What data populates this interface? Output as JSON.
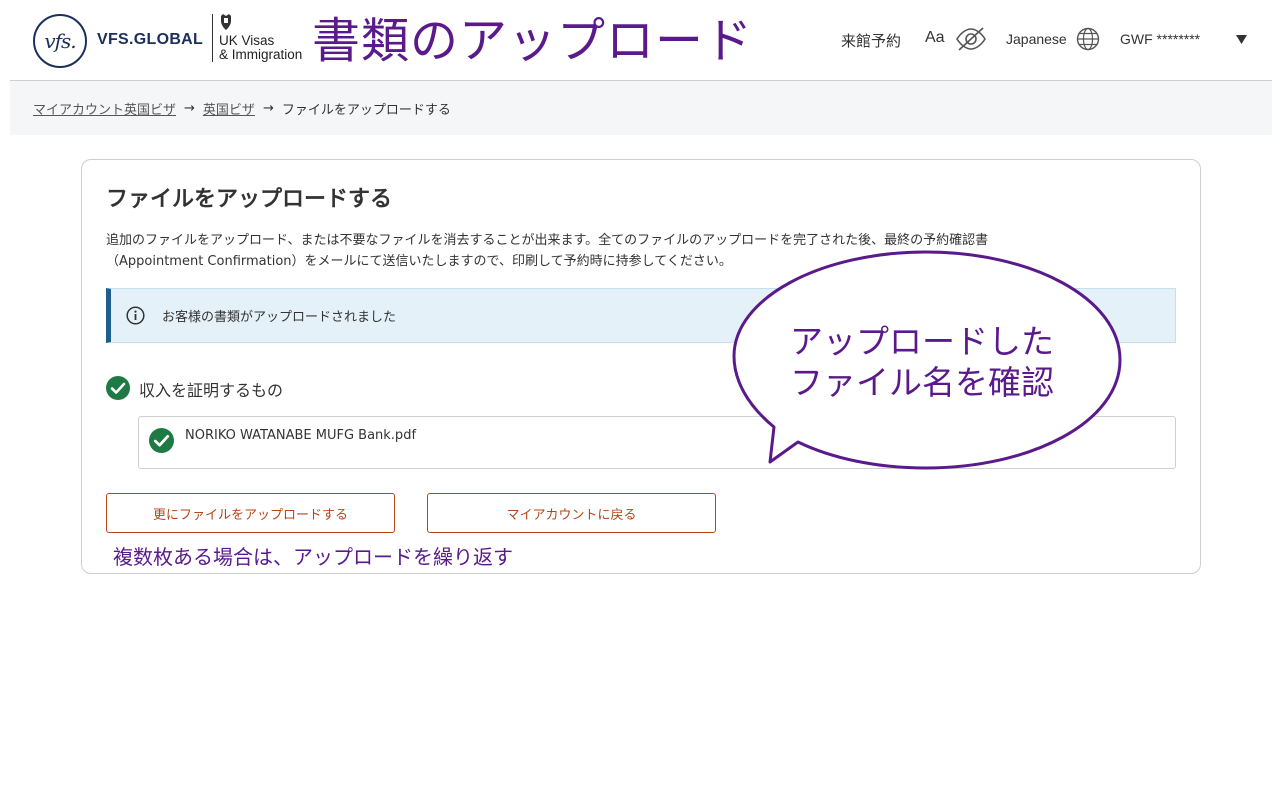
{
  "header": {
    "vfs_logo_text": "vfs.",
    "vfs_name": "VFS.GLOBAL",
    "ukvi_line1": "UK Visas",
    "ukvi_line2": "& Immigration",
    "page_heading": "書類のアップロード",
    "nav_reserve": "来館予約",
    "nav_font_size": "Aa",
    "nav_language": "Japanese",
    "nav_user": "GWF ********"
  },
  "breadcrumb": {
    "items": [
      "マイアカウント英国ビザ",
      "英国ビザ",
      "ファイルをアップロードする"
    ],
    "separator": "→"
  },
  "card": {
    "title": "ファイルをアップロードする",
    "description_line1": "追加のファイルをアップロード、または不要なファイルを消去することが出来ます。全てのファイルのアップロードを完了された後、最終の予約確認書",
    "description_line2": "（Appointment Confirmation）をメールにて送信いたしますので、印刷して予約時に持参してください。",
    "alert_text": "お客様の書類がアップロードされました",
    "document_category": "収入を証明するもの",
    "uploaded_file": "NORIKO WATANABE MUFG Bank.pdf",
    "upload_more_label": "更にファイルをアップロードする",
    "back_label": "マイアカウントに戻る"
  },
  "annotations": {
    "callout_line1": "アップロードした",
    "callout_line2": "ファイル名を確認",
    "repeat_note": "複数枚ある場合は、アップロードを繰り返す"
  },
  "colors": {
    "annotation_purple": "#5a1a8c",
    "brand_navy": "#1b2f5c",
    "button_accent": "#b5451b",
    "success_green": "#1e7a45",
    "alert_bg": "#e5f1f8",
    "alert_border": "#1d5e8c"
  },
  "icons": [
    "vfs-logo",
    "crest-icon",
    "eye-slash-icon",
    "globe-icon",
    "caret-down-icon",
    "info-icon",
    "check-circle-icon"
  ]
}
